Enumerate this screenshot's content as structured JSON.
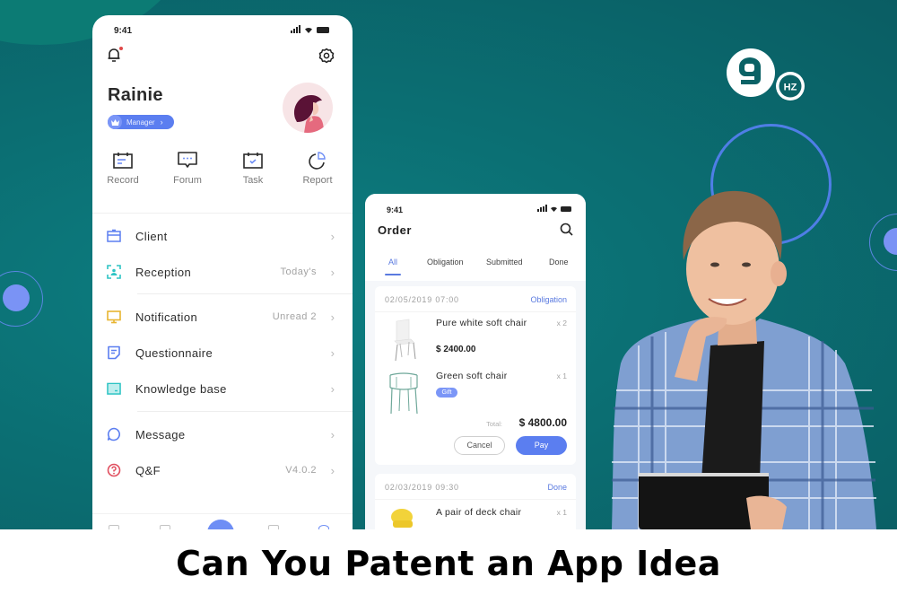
{
  "banner": {
    "headline": "Can You Patent an App Idea",
    "colors": {
      "background": "#0b6f73",
      "accent": "#5b7ef0",
      "footer": "#ffffff"
    }
  },
  "logo": {
    "numeral": "9",
    "suffix": "HZ"
  },
  "profile_screen": {
    "status_time": "9:41",
    "user": {
      "name": "Rainie",
      "role_badge": "Manager"
    },
    "quick_actions": [
      {
        "label": "Record",
        "icon": "calendar-note-icon"
      },
      {
        "label": "Forum",
        "icon": "chat-bubble-icon"
      },
      {
        "label": "Task",
        "icon": "calendar-check-icon"
      },
      {
        "label": "Report",
        "icon": "pie-chart-icon"
      }
    ],
    "menu": [
      {
        "label": "Client",
        "value": "",
        "icon": "briefcase-icon",
        "color": "#5b7ef0"
      },
      {
        "label": "Reception",
        "value": "Today's",
        "icon": "scan-face-icon",
        "color": "#2ec4c4"
      },
      {
        "label": "Notification",
        "value": "Unread 2",
        "icon": "monitor-icon",
        "color": "#e8b531"
      },
      {
        "label": "Questionnaire",
        "value": "",
        "icon": "form-icon",
        "color": "#5b7ef0"
      },
      {
        "label": "Knowledge base",
        "value": "",
        "icon": "folder-icon",
        "color": "#2ec4c4"
      },
      {
        "label": "Message",
        "value": "",
        "icon": "message-circle-icon",
        "color": "#5b7ef0"
      },
      {
        "label": "Q&F",
        "value": "V4.0.2",
        "icon": "help-circle-icon",
        "color": "#e04f5f"
      }
    ]
  },
  "order_screen": {
    "status_time": "9:41",
    "title": "Order",
    "tabs": [
      {
        "label": "All",
        "active": true
      },
      {
        "label": "Obligation",
        "active": false
      },
      {
        "label": "Submitted",
        "active": false
      },
      {
        "label": "Done",
        "active": false
      }
    ],
    "orders": [
      {
        "date": "02/05/2019 07:00",
        "status": "Obligation",
        "items": [
          {
            "name": "Pure white soft chair",
            "qty": "x 2",
            "price": "$ 2400.00",
            "tag": ""
          },
          {
            "name": "Green soft chair",
            "qty": "x 1",
            "price": "",
            "tag": "Gift"
          }
        ],
        "total_label": "Total:",
        "total": "$ 4800.00",
        "actions": {
          "cancel": "Cancel",
          "pay": "Pay"
        }
      },
      {
        "date": "02/03/2019 09:30",
        "status": "Done",
        "items": [
          {
            "name": "A pair of deck chair",
            "qty": "x 1",
            "price": "",
            "tag": ""
          }
        ]
      }
    ]
  }
}
